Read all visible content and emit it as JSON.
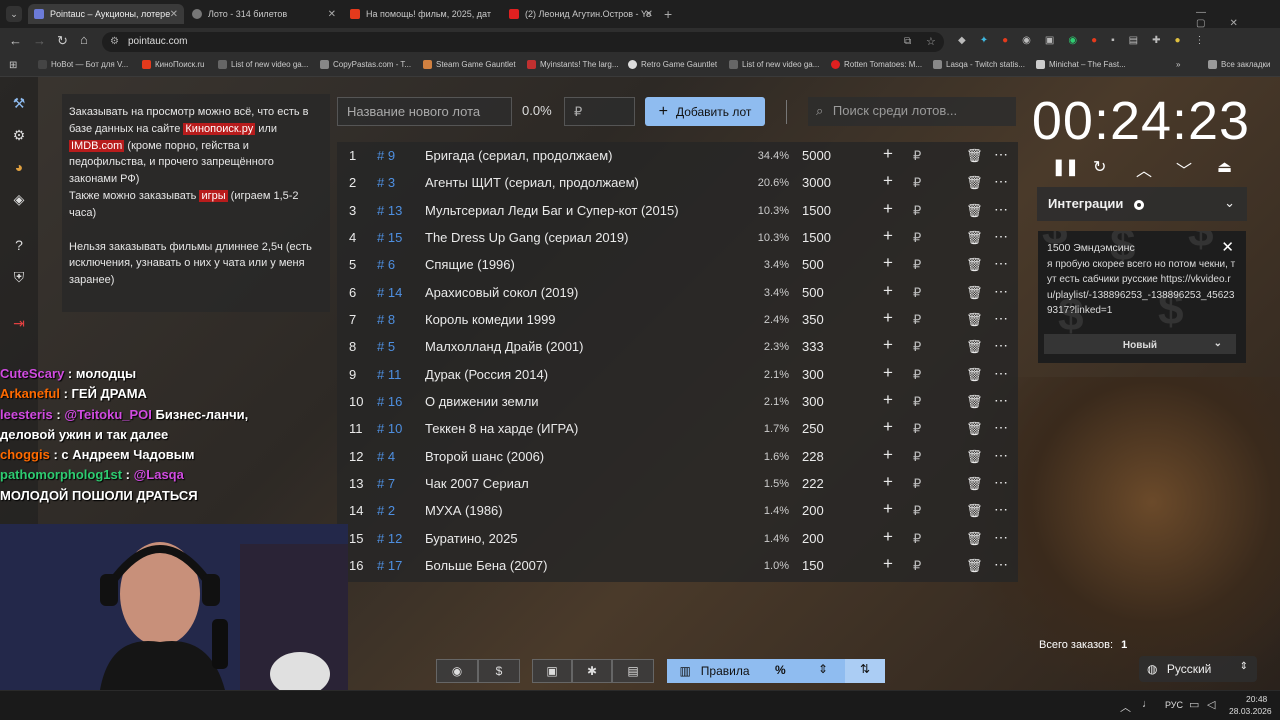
{
  "tabs": [
    {
      "title": "Pointauc – Аукционы, лотере",
      "active": true,
      "favicon": "#6c7bd8"
    },
    {
      "title": "Лото - 314 билетов",
      "active": false,
      "favicon": "#888"
    },
    {
      "title": "На помощь! фильм, 2025, дат",
      "active": false,
      "favicon": "#e53a1c"
    },
    {
      "title": "(2) Леонид Агутин.Остров - Yo",
      "active": false,
      "favicon": "#e02020"
    }
  ],
  "address": "pointauc.com",
  "bookmarks": [
    "HoBot — Бот для V...",
    "КиноПоиск.ru",
    "List of new video ga...",
    "CopyPastas.com - T...",
    "Steam Game Gauntlet",
    "Myinstants! The larg...",
    "Retro Game Gauntlet",
    "List of new video ga...",
    "Rotten Tomatoes: M...",
    "Lasqa - Twitch statis...",
    "Minichat – The Fast...",
    "Все закладки"
  ],
  "info": {
    "p1_a": "Заказывать на просмотр можно всё, что есть в базе данных на сайте ",
    "p1_link1": "Кинопоиск.ру",
    "p1_b": " или ",
    "p1_link2": "IMDB.com",
    "p1_c": " (кроме порно, гейства и педофильства, и прочего запрещённого законами РФ)",
    "p2_a": "Также можно заказывать ",
    "p2_link": "игры",
    "p2_b": " (играем 1,5-2 часа)",
    "p3": "Нельзя заказывать фильмы длиннее 2,5ч (есть исключения, узнавать о них у чата или у меня заранее)"
  },
  "toolbar": {
    "lot_placeholder": "Название нового лота",
    "percent": "0.0%",
    "rub": "₽",
    "add_label": "Добавить лот",
    "search_placeholder": "Поиск среди лотов..."
  },
  "lots": [
    {
      "n": "1",
      "id": "# 9",
      "name": "Бригада (сериал, продолжаем)",
      "pct": "34.4%",
      "value": "5000"
    },
    {
      "n": "2",
      "id": "# 3",
      "name": "Агенты ЩИТ (сериал, продолжаем)",
      "pct": "20.6%",
      "value": "3000"
    },
    {
      "n": "3",
      "id": "# 13",
      "name": "Мультсериал Леди Баг и Супер-кот (2015)",
      "pct": "10.3%",
      "value": "1500"
    },
    {
      "n": "4",
      "id": "# 15",
      "name": "The Dress Up Gang (сериал 2019)",
      "pct": "10.3%",
      "value": "1500"
    },
    {
      "n": "5",
      "id": "# 6",
      "name": "Спящие (1996)",
      "pct": "3.4%",
      "value": "500"
    },
    {
      "n": "6",
      "id": "# 14",
      "name": " Арахисовый сокол (2019)",
      "pct": "3.4%",
      "value": "500"
    },
    {
      "n": "7",
      "id": "# 8",
      "name": "Король комедии 1999",
      "pct": "2.4%",
      "value": "350"
    },
    {
      "n": "8",
      "id": "# 5",
      "name": "Малхолланд Драйв (2001)",
      "pct": "2.3%",
      "value": "333"
    },
    {
      "n": "9",
      "id": "# 11",
      "name": "Дурак (Россия 2014)",
      "pct": "2.1%",
      "value": "300"
    },
    {
      "n": "10",
      "id": "# 16",
      "name": "О движении земли",
      "pct": "2.1%",
      "value": "300"
    },
    {
      "n": "11",
      "id": "# 10",
      "name": "Теккен 8 на харде (ИГРА)",
      "pct": "1.7%",
      "value": "250"
    },
    {
      "n": "12",
      "id": "# 4",
      "name": "Второй шанс (2006)",
      "pct": "1.6%",
      "value": "228"
    },
    {
      "n": "13",
      "id": "# 7",
      "name": "Чак 2007 Сериал",
      "pct": "1.5%",
      "value": "222"
    },
    {
      "n": "14",
      "id": "# 2",
      "name": "МУХА (1986)",
      "pct": "1.4%",
      "value": "200"
    },
    {
      "n": "15",
      "id": "# 12",
      "name": "Буратино, 2025",
      "pct": "1.4%",
      "value": "200"
    },
    {
      "n": "16",
      "id": "# 17",
      "name": "Больше Бена (2007)",
      "pct": "1.0%",
      "value": "150"
    }
  ],
  "timer": "00:24:23",
  "integrations_label": "Интеграции",
  "donation": {
    "title": "1500 Эмндэмсинс",
    "text": "я пробую скорее всего но потом чекни, тут есть сабчики русские https://vkvideo.ru/playlist/-138896253_-138896253_456239317?linked=1",
    "button": "Новый"
  },
  "chat": [
    {
      "user": "CuteScary",
      "color": "#d04be0",
      "msg": "молодцы"
    },
    {
      "user": "Arkaneful",
      "color": "#ff6a00",
      "msg": "ГЕЙ ДРАМА"
    },
    {
      "user": "leesteris",
      "color": "#d04be0",
      "msg": "@Teitoku_POI",
      "msg2": "Бизнес-ланчи, деловой ужин и так далее"
    },
    {
      "user": "choggis",
      "color": "#ff6a00",
      "msg": "с Андреем Чадовым"
    },
    {
      "user": "pathomorpholog1st",
      "color": "#2ecc71",
      "msg": "@Lasqa",
      "msg2": "МОЛОДОЙ ПОШОЛИ ДРАТЬСЯ"
    }
  ],
  "total_orders_label": "Всего заказов:",
  "total_orders": "1",
  "rules_label": "Правила",
  "language": "Русский",
  "taskbar": {
    "lang": "РУС",
    "time": "20:48",
    "date": "28.03.2026"
  }
}
